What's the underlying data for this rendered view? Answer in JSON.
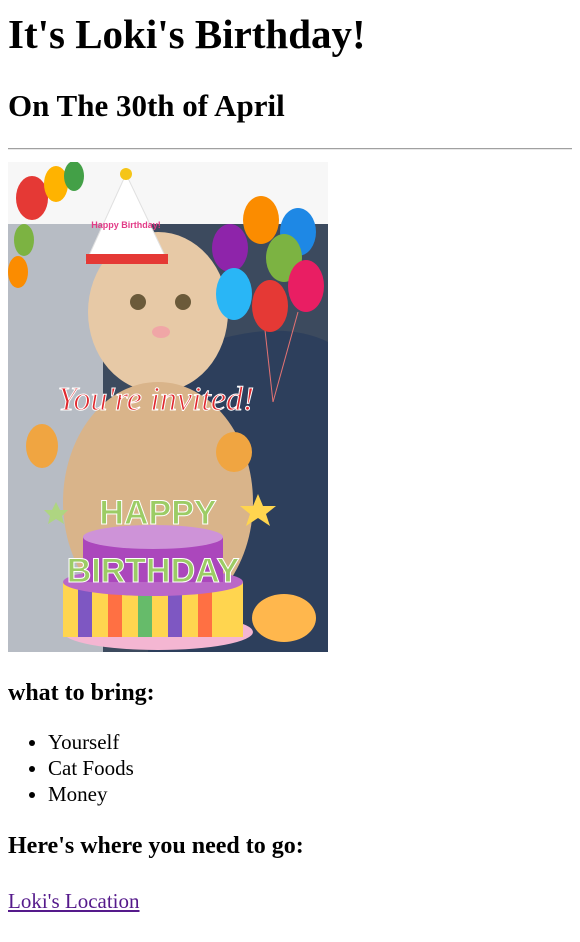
{
  "page": {
    "title": "It's Loki's Birthday!",
    "subtitle": "On The 30th of April"
  },
  "invitation": {
    "banner_text": "You're invited!",
    "hat_text": "Happy Birthday!",
    "cake_text_top": "HAPPY",
    "cake_text_bottom": "BIRTHDAY"
  },
  "bring": {
    "heading": "what to bring:",
    "items": [
      "Yourself",
      "Cat Foods",
      "Money"
    ]
  },
  "location": {
    "heading": "Here's where you need to go:",
    "link_text": "Loki's Location"
  },
  "colors": {
    "link_visited": "#551a8b",
    "divider": "#a0a0a0"
  }
}
